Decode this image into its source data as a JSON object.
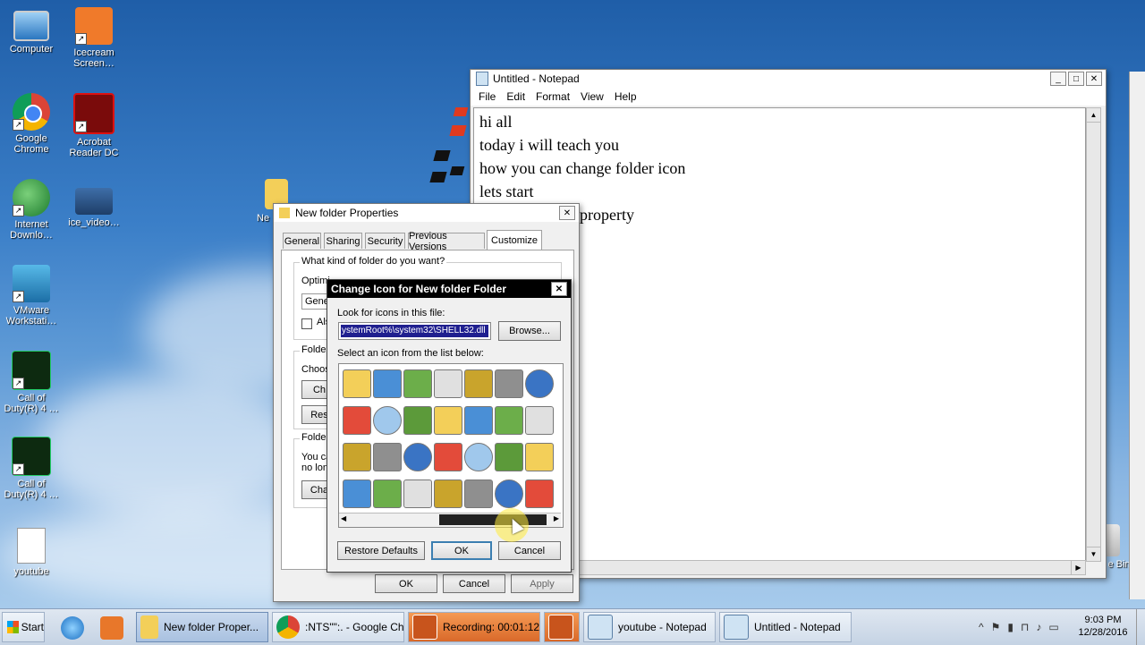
{
  "desktop": {
    "icons": [
      {
        "label": "Computer"
      },
      {
        "label": "Icecream Screen…"
      },
      {
        "label": "Google Chrome"
      },
      {
        "label": "Acrobat Reader DC"
      },
      {
        "label": "Internet Downlo…"
      },
      {
        "label": "ice_video…"
      },
      {
        "label": "VMware Workstati…"
      },
      {
        "label": "Call of Duty(R) 4 …"
      },
      {
        "label": "Call of Duty(R) 4 …"
      },
      {
        "label": "youtube"
      },
      {
        "label": "Ne"
      },
      {
        "label": "e Bin"
      }
    ]
  },
  "notepad": {
    "title": "Untitled - Notepad",
    "menu": [
      "File",
      "Edit",
      "Format",
      "View",
      "Help"
    ],
    "lines": [
      "hi all",
      "today i will teach you",
      "how you can change folder icon",
      "lets start",
      "property"
    ]
  },
  "properties": {
    "title": "New folder Properties",
    "tabs": [
      "General",
      "Sharing",
      "Security",
      "Previous Versions",
      "Customize"
    ],
    "group1_label": "What kind of folder do you want?",
    "optimize_partial": "Optimi",
    "select_partial": "Gene",
    "also_partial": "Als",
    "group2_label": "Folder",
    "choose_partial": "Choos",
    "ch_btn_partial": "Ch",
    "res_btn_partial": "Res",
    "group3_label": "Folder",
    "you_can_partial": "You ca",
    "no_lon_partial": "no lon",
    "cha_btn_partial": "Cha",
    "ok": "OK",
    "cancel": "Cancel",
    "apply": "Apply"
  },
  "change_icon": {
    "title": "Change Icon for New folder Folder",
    "look_label": "Look for icons in this file:",
    "file_value": "ystemRoot%\\system32\\SHELL32.dll",
    "browse": "Browse...",
    "select_label": "Select an icon from the list below:",
    "restore": "Restore Defaults",
    "ok": "OK",
    "cancel": "Cancel"
  },
  "taskbar": {
    "start": "Start",
    "tasks": [
      {
        "label": "New folder Proper..."
      },
      {
        "label": ":NTS\"\":. - Google Chr..."
      },
      {
        "label": "Recording:  00:01:12"
      },
      {
        "label": "youtube - Notepad"
      },
      {
        "label": "Untitled - Notepad"
      }
    ],
    "time": "9:03 PM",
    "date": "12/28/2016"
  },
  "colors": {
    "accent": "#1f5ea8",
    "dialog_title_bg": "#000000",
    "selection": "#1f1f8f"
  }
}
